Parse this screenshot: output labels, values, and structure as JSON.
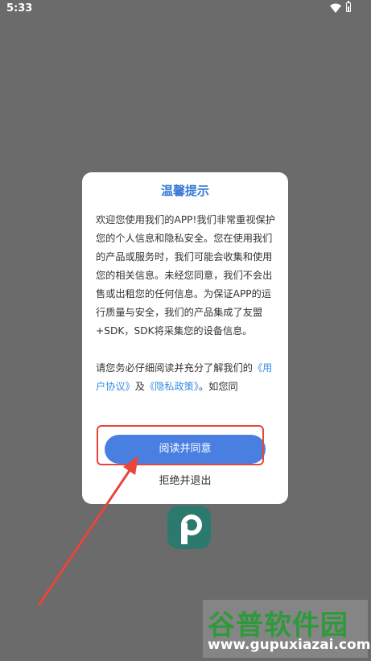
{
  "status_bar": {
    "time": "5:33",
    "wifi_icon": "wifi-icon",
    "battery_icon": "battery-icon"
  },
  "dialog": {
    "title": "温馨提示",
    "paragraph_1": "欢迎您使用我们的APP!我们非常重视保护您的个人信息和隐私安全。您在使用我们的产品或服务时，我们可能会收集和使用您的相关信息。未经您同意，我们不会出售或出租您的任何信息。为保证APP的运行质量与安全，我们的产品集成了友盟+SDK，SDK将采集您的设备信息。",
    "paragraph_2_prefix": "请您务必仔细阅读并充分了解我们的",
    "user_agreement_link": "《用户协议》",
    "and_text": "及",
    "privacy_policy_link": "《隐私政策》",
    "paragraph_2_suffix": "。如您同",
    "agree_button": "阅读并同意",
    "exit_button": "拒绝并退出"
  },
  "watermark": {
    "title": "谷普软件园",
    "url": "www.gupuxiazai.com"
  },
  "colors": {
    "accent": "#3578d6",
    "button": "#4a7fe2",
    "link": "#3a8ee6",
    "annotation": "#e8463a"
  }
}
